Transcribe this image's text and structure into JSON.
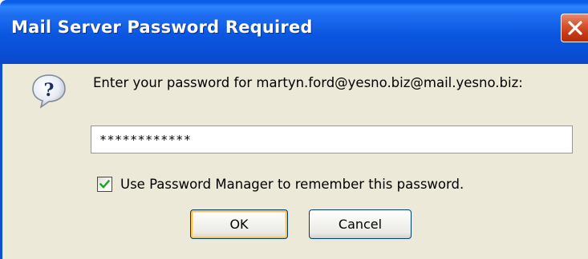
{
  "window": {
    "title": "Mail Server Password Required"
  },
  "prompt": {
    "text": "Enter your password for martyn.ford@yesno.biz@mail.yesno.biz:"
  },
  "password_field": {
    "value": "************"
  },
  "remember_checkbox": {
    "label": "Use Password Manager to remember this password.",
    "checked": true
  },
  "buttons": {
    "ok_label": "OK",
    "cancel_label": "Cancel"
  },
  "icons": {
    "dialog": "question-icon",
    "close": "close-icon",
    "check": "checkmark-icon"
  },
  "colors": {
    "titlebar": "#0a56e0",
    "dialog_background": "#ece9d8",
    "close_button": "#c63a16",
    "checkmark": "#21a121",
    "default_button_glow": "#f4c35a"
  }
}
